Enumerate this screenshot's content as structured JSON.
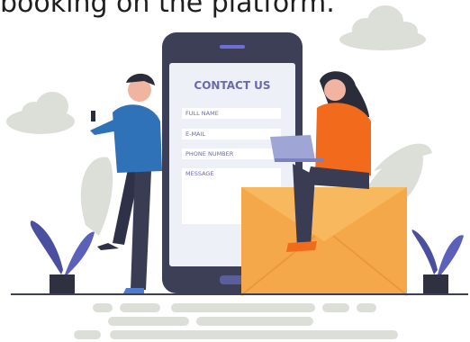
{
  "header": {
    "text": "booking on the platform."
  },
  "form": {
    "title": "CONTACT US",
    "fields": [
      {
        "label": "FULL NAME"
      },
      {
        "label": "E-MAIL"
      },
      {
        "label": "PHONE NUMBER"
      },
      {
        "label": "MESSAGE"
      }
    ]
  },
  "colors": {
    "phone_body": "#3d3f57",
    "screen": "#eef0f8",
    "envelope": "#f5a84a",
    "man_shirt": "#2f72b8",
    "woman_shirt": "#f26a1b",
    "cloud": "#d9ddd6",
    "plant_leaf": "#4a4fa0",
    "pot": "#2f3140"
  }
}
